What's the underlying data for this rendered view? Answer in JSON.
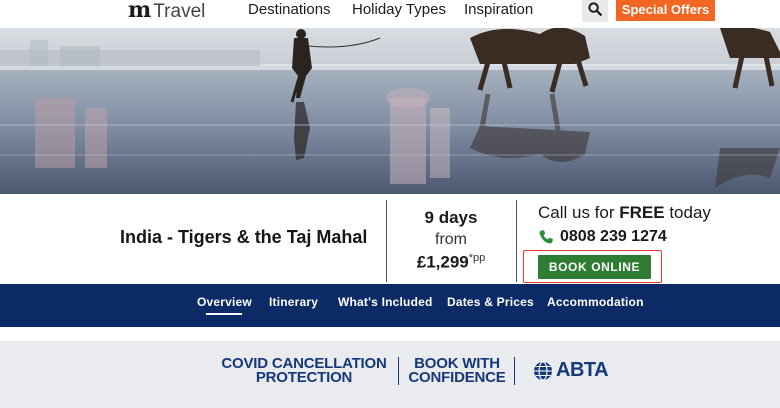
{
  "brand": {
    "logo_mark": "m",
    "logo_word": "Travel"
  },
  "nav": {
    "items": [
      "Destinations",
      "Holiday Types",
      "Inspiration"
    ],
    "search_icon": "search-icon",
    "special_offers": "Special Offers"
  },
  "colors": {
    "accent_orange": "#f26522",
    "navy": "#0c2b66",
    "book_green": "#2e7d32",
    "highlight_red": "#e63b2e",
    "banner_bg": "#e9ebee",
    "banner_text": "#17397a"
  },
  "tour": {
    "title": "India - Tigers & the Taj Mahal",
    "duration": "9 days",
    "from_label": "from",
    "price": "£1,299",
    "price_suffix": "*pp"
  },
  "contact": {
    "call_prefix": "Call us for ",
    "call_bold": "FREE",
    "call_suffix": " today",
    "phone_icon": "phone-icon",
    "phone": "0808 239 1274",
    "book_label": "BOOK ONLINE"
  },
  "tabs": [
    {
      "label": "Overview",
      "active": true
    },
    {
      "label": "Itinerary",
      "active": false
    },
    {
      "label": "What's Included",
      "active": false
    },
    {
      "label": "Dates & Prices",
      "active": false
    },
    {
      "label": "Accommodation",
      "active": false
    }
  ],
  "banner": {
    "covid_line1": "COVID CANCELLATION",
    "covid_line2": "PROTECTION",
    "book_line1": "BOOK WITH",
    "book_line2": "CONFIDENCE",
    "abta_icon": "abta-globe-icon",
    "abta": "ABTA"
  }
}
